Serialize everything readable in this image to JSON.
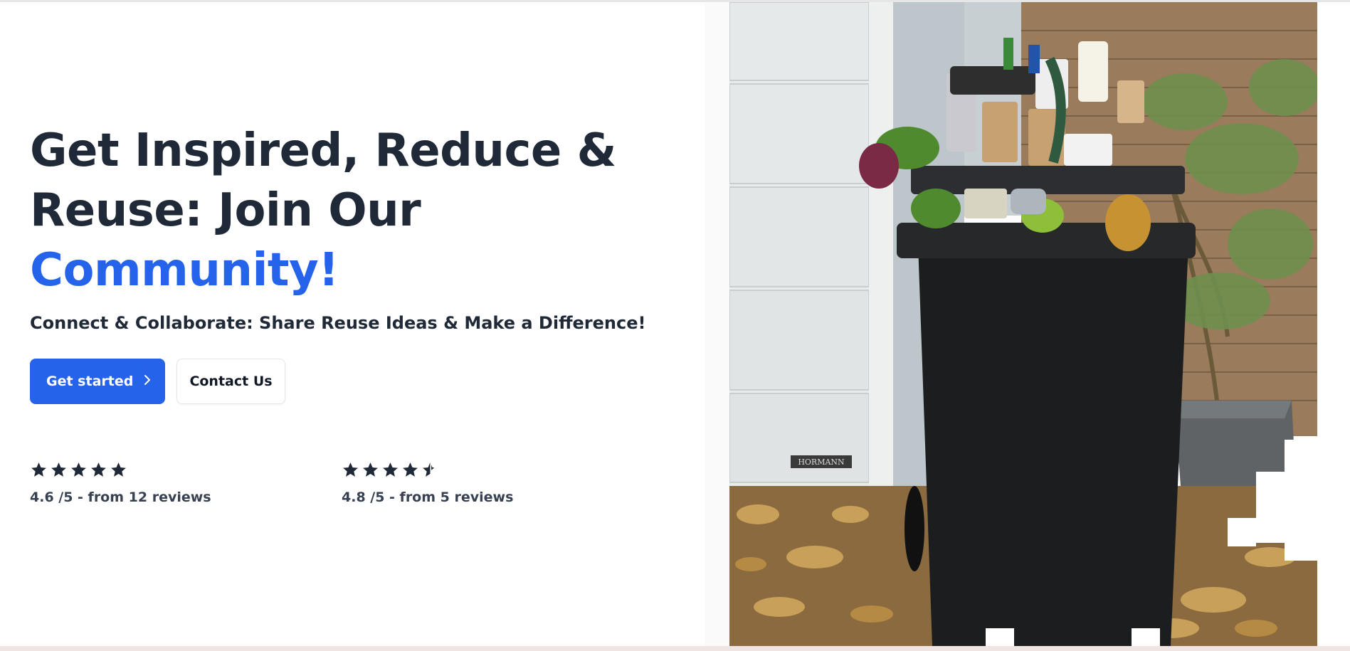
{
  "hero": {
    "headline_line1": "Get Inspired, Reduce &",
    "headline_line2": "Reuse: Join Our",
    "headline_accent": "Community!",
    "subheadline": "Connect & Collaborate: Share Reuse Ideas & Make a Difference!",
    "primary_button": {
      "label": "Get started",
      "icon": "chevron-right-icon"
    },
    "secondary_button": {
      "label": "Contact Us"
    }
  },
  "ratings": [
    {
      "stars": 5,
      "text": "4.6 /5 - from 12 reviews"
    },
    {
      "stars": 4.5,
      "text": "4.8 /5 - from 5 reviews"
    }
  ],
  "image": {
    "description_icon": "overflowing-trash-bin-photo",
    "door_label": "HORMANN"
  },
  "colors": {
    "heading": "#1f2937",
    "accent": "#2563eb",
    "button_primary": "#2563eb",
    "star": "#1f2937"
  }
}
